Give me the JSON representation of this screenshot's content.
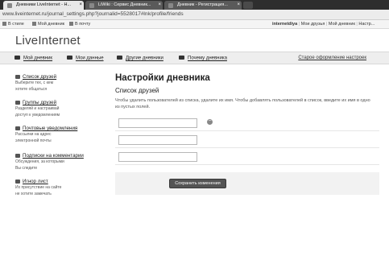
{
  "browser": {
    "tabs": [
      {
        "label": "Дневники LiveInternet - Н..."
      },
      {
        "label": "LiWiki : Сервис Дневник..."
      },
      {
        "label": "Дневник - Регистрация..."
      }
    ],
    "url": "www.liveinternet.ru/journal_settings.php?journalid=5528017#lnk/profile/friends",
    "bookmarks": [
      "В стиле",
      "Мой дневник",
      "В почту"
    ],
    "user": {
      "name": "internetdiya",
      "links": [
        "Мои друзья",
        "Мой дневник",
        "Настр..."
      ]
    }
  },
  "site": {
    "logo": "LiveInternet",
    "nav": [
      {
        "label": "Мой дневник",
        "icon": "notebook-icon"
      },
      {
        "label": "Мои данные",
        "icon": "id-card-icon"
      },
      {
        "label": "Другие дневники",
        "icon": "people-icon"
      },
      {
        "label": "Почему дневника",
        "icon": "gear-icon"
      }
    ],
    "nav_right": "Старое оформление настроек"
  },
  "sidebar": {
    "items": [
      {
        "title": "Список друзей",
        "desc": [
          "Выберите тех, с кем",
          "хотите общаться"
        ],
        "icon": "friends-icon"
      },
      {
        "title": "Группы друзей",
        "desc": [
          "Разделяй и настраивай",
          "доступ к уведомлениям"
        ],
        "icon": "groups-icon"
      },
      {
        "title": "Почтовые уведомления",
        "desc": [
          "Рассылки на адрес",
          "электронной почты"
        ],
        "icon": "mail-icon"
      },
      {
        "title": "Подписки на комментарии",
        "desc": [
          "Обсуждения, за которыми",
          "Вы следите"
        ],
        "icon": "comment-icon"
      },
      {
        "title": "Игнор лист",
        "desc": [
          "Их присутствие на сайте",
          "не хотите замечать"
        ],
        "icon": "block-icon"
      }
    ]
  },
  "main": {
    "title": "Настройки дневника",
    "subtitle": "Список друзей",
    "description": "Чтобы удалить пользователей из списка, удалите их имя. Чтобы добавлять пользователей в список, введите их имя в одно из пустых полей.",
    "inputs": [
      "",
      "",
      ""
    ],
    "save_label": "Сохранить изменения"
  }
}
